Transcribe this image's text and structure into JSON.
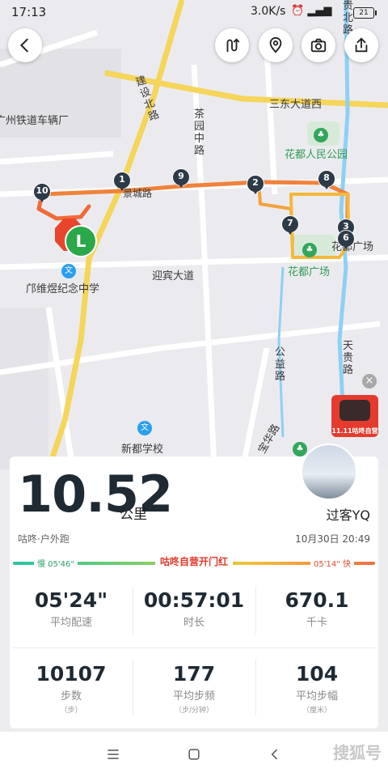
{
  "status_bar": {
    "time": "17:13",
    "speed": "3.0K/s",
    "battery": "21"
  },
  "map": {
    "labels": {
      "jianshe": "建设北路",
      "chayuan": "茶园中路",
      "sandong": "三东大道西",
      "railway": "广州铁道车辆厂",
      "park": "花都人民公园",
      "yingbin": "迎宾大道",
      "school1": "邝维煜纪念中学",
      "huadu_sq_green": "花都广场",
      "huadu_sq": "花都广场",
      "gongyi": "公益路",
      "tiangui": "天贵路",
      "guibei": "贵北路",
      "baohua": "宝华路",
      "xindu": "新都学校",
      "xinglu": "景城路"
    },
    "markers": [
      "1",
      "2",
      "3",
      "6",
      "7",
      "8",
      "9",
      "10"
    ],
    "start_marker": "L",
    "ad_text": "11.11咕咚自营",
    "edu_icon": "文"
  },
  "toolbar": {
    "back": "back-icon",
    "route": "route-icon",
    "location": "location-icon",
    "camera": "camera-icon",
    "share": "share-icon"
  },
  "card": {
    "distance": "10.52",
    "distance_unit": "公里",
    "username": "过客YQ",
    "source": "咕咚·户外跑",
    "datetime": "10月30日 20:49",
    "pace_slow": "慢 05'46\"",
    "pace_fast": "05'14\" 快",
    "pace_banner": "咕咚自营开门红",
    "stats": [
      {
        "value": "05'24\"",
        "label": "平均配速",
        "sub": ""
      },
      {
        "value": "00:57:01",
        "label": "时长",
        "sub": ""
      },
      {
        "value": "670.1",
        "label": "千卡",
        "sub": ""
      },
      {
        "value": "10107",
        "label": "步数",
        "sub": "（步）"
      },
      {
        "value": "177",
        "label": "平均步频",
        "sub": "（步/分钟）"
      },
      {
        "value": "104",
        "label": "平均步幅",
        "sub": "（厘米）"
      }
    ]
  },
  "watermark": "搜狐号"
}
